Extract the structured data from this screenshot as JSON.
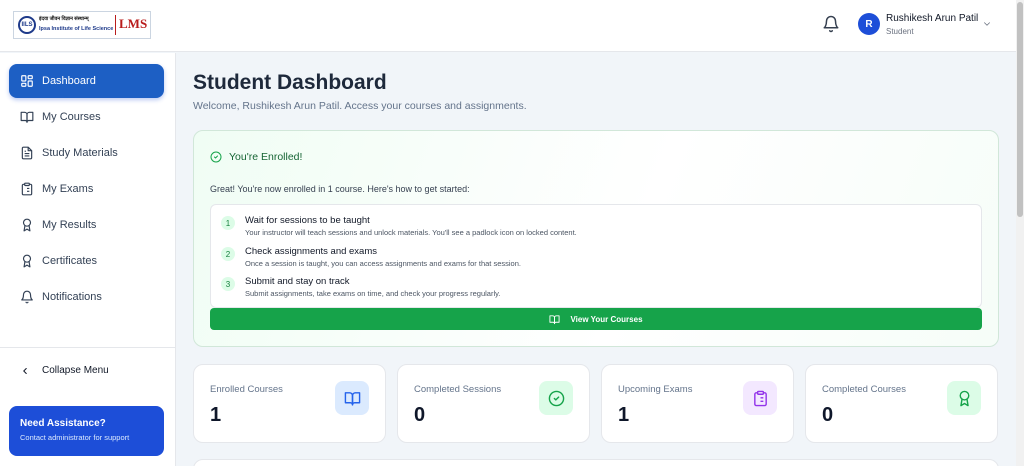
{
  "header": {
    "logo": {
      "emblem": "IILS",
      "hindi": "इंदवा जीवन विज्ञान संस्थान्म्",
      "english": "Ipsa Institute of Life Science",
      "lms": "LMS"
    },
    "user": {
      "initial": "R",
      "name": "Rushikesh Arun Patil",
      "role": "Student"
    }
  },
  "sidebar": {
    "items": [
      {
        "label": "Dashboard",
        "icon": "dashboard-icon",
        "active": true
      },
      {
        "label": "My Courses",
        "icon": "book-icon"
      },
      {
        "label": "Study Materials",
        "icon": "document-icon"
      },
      {
        "label": "My Exams",
        "icon": "clipboard-icon"
      },
      {
        "label": "My Results",
        "icon": "award-icon"
      },
      {
        "label": "Certificates",
        "icon": "certificate-icon"
      },
      {
        "label": "Notifications",
        "icon": "bell-icon"
      }
    ],
    "collapse_label": "Collapse Menu",
    "assist": {
      "title": "Need Assistance?",
      "subtitle": "Contact administrator for support"
    }
  },
  "main": {
    "title": "Student Dashboard",
    "subtitle": "Welcome, Rushikesh Arun Patil. Access your courses and assignments.",
    "enroll": {
      "heading": "You're Enrolled!",
      "intro": "Great! You're now enrolled in 1 course. Here's how to get started:",
      "steps": [
        {
          "num": "1",
          "title": "Wait for sessions to be taught",
          "desc": "Your instructor will teach sessions and unlock materials. You'll see a padlock icon on locked content."
        },
        {
          "num": "2",
          "title": "Check assignments and exams",
          "desc": "Once a session is taught, you can access assignments and exams for that session."
        },
        {
          "num": "3",
          "title": "Submit and stay on track",
          "desc": "Submit assignments, take exams on time, and check your progress regularly."
        }
      ],
      "button_label": "View Your Courses"
    },
    "stats": [
      {
        "label": "Enrolled Courses",
        "value": "1",
        "icon": "book-icon",
        "color": "#2563eb",
        "bg": "#dbeafe"
      },
      {
        "label": "Completed Sessions",
        "value": "0",
        "icon": "check-circle-icon",
        "color": "#16a34a",
        "bg": "#dcfce7"
      },
      {
        "label": "Upcoming Exams",
        "value": "1",
        "icon": "clipboard-icon",
        "color": "#9333ea",
        "bg": "#f3e8ff"
      },
      {
        "label": "Completed Courses",
        "value": "0",
        "icon": "award-icon",
        "color": "#16a34a",
        "bg": "#dcfce7"
      }
    ]
  }
}
